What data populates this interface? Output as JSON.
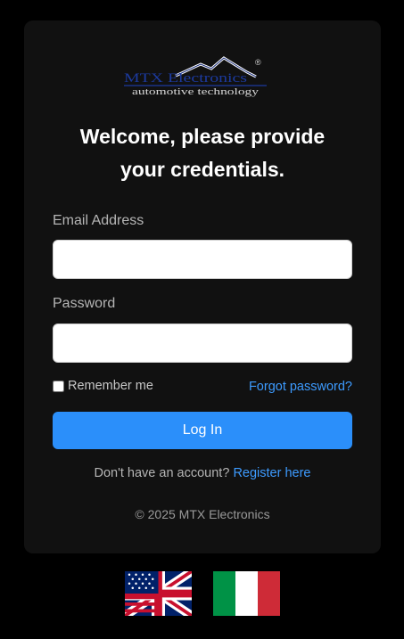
{
  "brand": {
    "logo_text": "MTX Electronics",
    "logo_tagline": "automotive technology",
    "logo_mark": "®"
  },
  "heading": {
    "line1": "Welcome, please provide",
    "line2": "your credentials."
  },
  "form": {
    "email_label": "Email Address",
    "email_value": "",
    "password_label": "Password",
    "password_value": "",
    "remember_label": "Remember me",
    "forgot_link": "Forgot password?",
    "login_button": "Log In"
  },
  "register": {
    "prompt": "Don't have an account?",
    "link": "Register here"
  },
  "footer": {
    "copyright": "© 2025 MTX Electronics"
  },
  "languages": [
    {
      "code": "en",
      "icon": "uk-flag-icon"
    },
    {
      "code": "it",
      "icon": "italy-flag-icon"
    }
  ],
  "colors": {
    "page_background": "#000000",
    "card_background": "#111111",
    "accent": "#2b8ffa",
    "link": "#3d9bff",
    "label": "#b5b5b5"
  }
}
